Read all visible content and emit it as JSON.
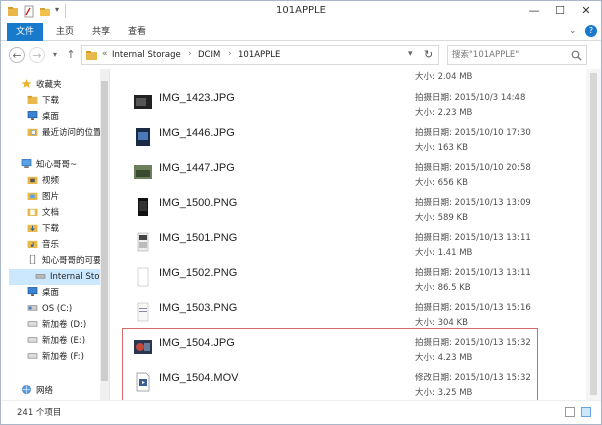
{
  "window": {
    "title": "101APPLE",
    "minimize": "—",
    "maximize": "☐",
    "close": "✕",
    "help": "?"
  },
  "ribbon": {
    "tabs": [
      "文件",
      "主页",
      "共享",
      "查看"
    ]
  },
  "nav": {
    "back": "←",
    "forward": "→",
    "recent": "▾",
    "up": "↑",
    "refresh": "↻"
  },
  "address": {
    "overflow": "«",
    "crumbs": [
      "Internal Storage",
      "DCIM",
      "101APPLE"
    ],
    "separator": "›",
    "dropdown": "▾"
  },
  "search": {
    "placeholder": "搜索\"101APPLE\""
  },
  "sidebar": {
    "items": [
      {
        "label": "收藏夹",
        "icon": "star-icon",
        "indent": 0
      },
      {
        "label": "下载",
        "icon": "folder-icon",
        "indent": 1
      },
      {
        "label": "桌面",
        "icon": "desktop-icon",
        "indent": 1
      },
      {
        "label": "最近访问的位置",
        "icon": "recent-icon",
        "indent": 1
      },
      {
        "label": "知心哥哥~",
        "icon": "computer-icon",
        "indent": 0
      },
      {
        "label": "视频",
        "icon": "folder-icon",
        "indent": 1
      },
      {
        "label": "图片",
        "icon": "folder-icon",
        "indent": 1
      },
      {
        "label": "文档",
        "icon": "folder-icon",
        "indent": 1
      },
      {
        "label": "下载",
        "icon": "folder-icon",
        "indent": 1
      },
      {
        "label": "音乐",
        "icon": "music-icon",
        "indent": 1
      },
      {
        "label": "知心哥哥的可要设",
        "icon": "phone-icon",
        "indent": 1
      },
      {
        "label": "Internal Stora",
        "icon": "drive-icon",
        "indent": 2
      },
      {
        "label": "桌面",
        "icon": "desktop-icon",
        "indent": 1
      },
      {
        "label": "OS (C:)",
        "icon": "os-drive-icon",
        "indent": 1
      },
      {
        "label": "新加卷 (D:)",
        "icon": "drive-icon",
        "indent": 1
      },
      {
        "label": "新加卷 (E:)",
        "icon": "drive-icon",
        "indent": 1
      },
      {
        "label": "新加卷 (F:)",
        "icon": "drive-icon",
        "indent": 1
      },
      {
        "label": "网络",
        "icon": "network-icon",
        "indent": 0
      }
    ]
  },
  "files": {
    "top_partial": {
      "size": "大小: 2.04 MB"
    },
    "items": [
      {
        "name": "IMG_1423.JPG",
        "meta1": "拍摄日期: 2015/10/3 14:48",
        "meta2": "大小: 2.23 MB",
        "thumb": "photo-dark"
      },
      {
        "name": "IMG_1446.JPG",
        "meta1": "拍摄日期: 2015/10/10 17:30",
        "meta2": "大小: 163 KB",
        "thumb": "photo-blue"
      },
      {
        "name": "IMG_1447.JPG",
        "meta1": "拍摄日期: 2015/10/10 20:58",
        "meta2": "大小: 656 KB",
        "thumb": "photo-green"
      },
      {
        "name": "IMG_1500.PNG",
        "meta1": "拍摄日期: 2015/10/13 13:09",
        "meta2": "大小: 589 KB",
        "thumb": "screen-dark"
      },
      {
        "name": "IMG_1501.PNG",
        "meta1": "拍摄日期: 2015/10/13 13:11",
        "meta2": "大小: 1.41 MB",
        "thumb": "screen-mixed"
      },
      {
        "name": "IMG_1502.PNG",
        "meta1": "拍摄日期: 2015/10/13 13:11",
        "meta2": "大小: 86.5 KB",
        "thumb": "screen-white"
      },
      {
        "name": "IMG_1503.PNG",
        "meta1": "拍摄日期: 2015/10/13 15:16",
        "meta2": "大小: 304 KB",
        "thumb": "screen-light"
      },
      {
        "name": "IMG_1504.JPG",
        "meta1": "拍摄日期: 2015/10/13 15:32",
        "meta2": "大小: 4.23 MB",
        "thumb": "photo-red"
      },
      {
        "name": "IMG_1504.MOV",
        "meta1": "修改日期: 2015/10/13 15:32",
        "meta2": "大小: 3.25 MB",
        "thumb": "video-file"
      }
    ]
  },
  "status": {
    "count": "241 个项目"
  },
  "colors": {
    "accent": "#1979ca",
    "highlight_border": "#d66a6a",
    "selection": "#cce8ff"
  }
}
